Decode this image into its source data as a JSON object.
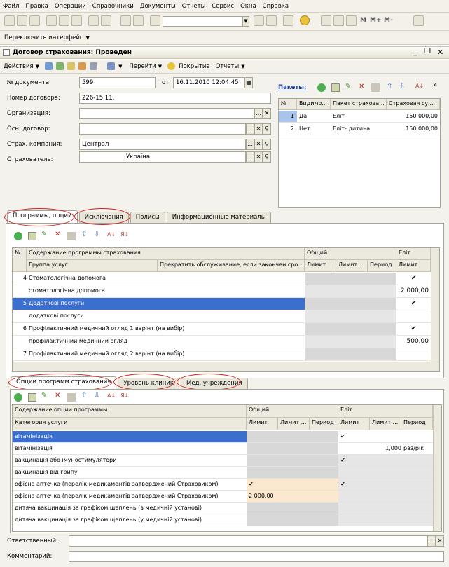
{
  "menu": [
    "Файл",
    "Правка",
    "Операции",
    "Справочники",
    "Документы",
    "Отчеты",
    "Сервис",
    "Окна",
    "Справка"
  ],
  "toolbar": {
    "interface_label": "Переключить интерфейс",
    "m_labels": [
      "M",
      "M+",
      "M-"
    ]
  },
  "window": {
    "title": "Договор страхования: Проведен"
  },
  "actions": {
    "actions": "Действия",
    "goto": "Перейти",
    "coverage": "Покрытие",
    "reports": "Отчеты"
  },
  "header": {
    "doc_no_label": "№ документа:",
    "doc_no": "599",
    "from_label": "от",
    "date": "16.11.2010 12:04:45",
    "contract_no_label": "Номер договора:",
    "contract_no": "226-15.11.",
    "org_label": "Организация:",
    "org": "",
    "base_contract_label": "Осн. договор:",
    "base_contract": "",
    "insurer_label": "Страх. компания:",
    "insurer": "Централ",
    "policyholder_label": "Страхователь:",
    "policyholder": "Україна"
  },
  "packets": {
    "label": "Пакеты:",
    "columns": [
      "№",
      "Видимо...",
      "Пакет страхова...",
      "Страховая су..."
    ],
    "rows": [
      [
        "1",
        "Да",
        "Еліт",
        "150 000,00"
      ],
      [
        "2",
        "Нет",
        "Еліт- дитина",
        "150 000,00"
      ]
    ]
  },
  "tabs_top": [
    "Программы, опции",
    "Исключения",
    "Полисы",
    "Информационные материалы"
  ],
  "programs": {
    "h_num": "№",
    "h_content": "Содержание программы страхования",
    "h_group": "Группа услуг",
    "h_stop": "Прекратить обслуживание, если закончен сро...",
    "h_common": "Общий",
    "h_limit": "Лимит",
    "h_limit2": "Лимит ...",
    "h_period": "Период",
    "h_elit": "Еліт",
    "h_limit3": "Лимит",
    "rows": [
      {
        "num": "4",
        "name": "Стоматологічна допомога",
        "check": "✔",
        "val": ""
      },
      {
        "num": "",
        "name": "стоматологічна допомога",
        "check": "",
        "val": "2 000,00"
      },
      {
        "num": "5",
        "name": "Додаткові послуги",
        "check": "✔",
        "val": ""
      },
      {
        "num": "",
        "name": "додаткові послуги",
        "check": "",
        "val": ""
      },
      {
        "num": "6",
        "name": "Профілактичний медичний огляд 1 варінт (на вибір)",
        "check": "✔",
        "val": ""
      },
      {
        "num": "",
        "name": "профілактичний медичний огляд",
        "check": "",
        "val": "500,00"
      },
      {
        "num": "7",
        "name": "Профілактичний медичний огляд 2 варінт (на вибір)",
        "check": "",
        "val": ""
      }
    ]
  },
  "tabs_bottom": [
    "Опции программ страхования",
    "Уровень клиник",
    "Мед. учреждения"
  ],
  "options": {
    "h_content": "Содержание опции программы",
    "h_category": "Категория услуги",
    "h_common": "Общий",
    "h_elit": "Еліт",
    "h_limit": "Лимит",
    "h_limit2": "Лимит ...",
    "h_period": "Период",
    "rows": [
      {
        "name": "вітамінізація",
        "c_chk": "",
        "c_val": "",
        "e_chk": "✔",
        "e_val": "",
        "e_per": ""
      },
      {
        "name": "вітамінізація",
        "c_chk": "",
        "c_val": "",
        "e_chk": "",
        "e_val": "1,000",
        "e_per": "раз/рік"
      },
      {
        "name": "вакцинація або імуностимулятори",
        "c_chk": "",
        "c_val": "",
        "e_chk": "✔",
        "e_val": "",
        "e_per": ""
      },
      {
        "name": "вакцинація від грипу",
        "c_chk": "",
        "c_val": "",
        "e_chk": "",
        "e_val": "",
        "e_per": ""
      },
      {
        "name": "офісна аптечка (перелік медикаментів затверджений Страховиком)",
        "c_chk": "✔",
        "c_val": "",
        "e_chk": "✔",
        "e_val": "",
        "e_per": ""
      },
      {
        "name": "офісна аптечка (перелік медикаментів затверджений Страховиком)",
        "c_chk": "",
        "c_val": "2 000,00",
        "e_chk": "",
        "e_val": "",
        "e_per": ""
      },
      {
        "name": "дитяча вакцинація за графіком щеплень (в медичній установі)",
        "c_chk": "",
        "c_val": "",
        "e_chk": "",
        "e_val": "",
        "e_per": ""
      },
      {
        "name": "дитяча вакцинація за графіком щеплень (у медичній установі)",
        "c_chk": "",
        "c_val": "",
        "e_chk": "",
        "e_val": "",
        "e_per": ""
      }
    ]
  },
  "footer": {
    "responsible_label": "Ответственный:",
    "comment_label": "Комментарий:"
  },
  "colors": {
    "selection": "#3b6fcf",
    "annotation": "#d21e1e",
    "peach": "#fce8cf"
  }
}
